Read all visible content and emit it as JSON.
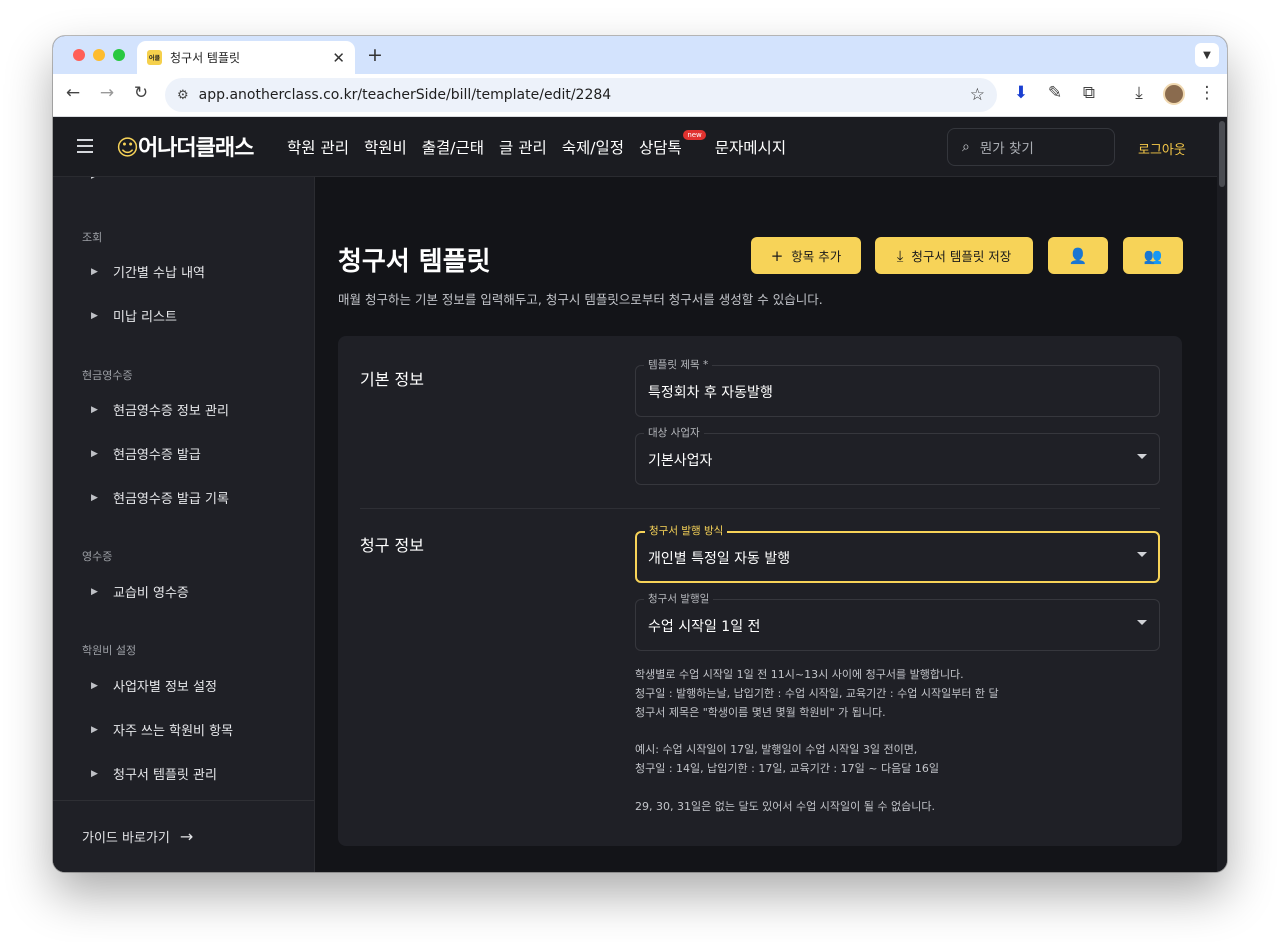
{
  "browser": {
    "tab_title": "청구서 템플릿",
    "favicon_text": "어클",
    "url": "app.anotherclass.co.kr/teacherSide/bill/template/edit/2284"
  },
  "appbar": {
    "logo_text": "어나더클래스",
    "nav": [
      "학원 관리",
      "학원비",
      "출결/근태",
      "글 관리",
      "숙제/일정",
      "상담톡",
      "문자메시지"
    ],
    "new_badge": "new",
    "search_placeholder": "뭔가 찾기",
    "logout": "로그아웃"
  },
  "sidebar": {
    "sections": [
      {
        "title": "조회",
        "items": [
          "기간별 수납 내역",
          "미납 리스트"
        ]
      },
      {
        "title": "현금영수증",
        "items": [
          "현금영수증 정보 관리",
          "현금영수증 발급",
          "현금영수증 발급 기록"
        ]
      },
      {
        "title": "영수증",
        "items": [
          "교습비 영수증"
        ]
      },
      {
        "title": "학원비 설정",
        "items": [
          "사업자별 정보 설정",
          "자주 쓰는 학원비 항목",
          "청구서 템플릿 관리"
        ]
      }
    ],
    "guide": "가이드 바로가기"
  },
  "main": {
    "title": "청구서 템플릿",
    "description": "매월 청구하는 기본 정보를 입력해두고, 청구시 템플릿으로부터 청구서를 생성할 수 있습니다.",
    "buttons": {
      "add_item": "항목 추가",
      "save_template": "청구서 템플릿 저장"
    },
    "basic": {
      "label": "기본 정보",
      "template_name_label": "템플릿 제목 *",
      "template_name_value": "특정회차 후 자동발행",
      "business_label": "대상 사업자",
      "business_value": "기본사업자"
    },
    "billing": {
      "label": "청구 정보",
      "method_label": "청구서 발행 방식",
      "method_value": "개인별 특정일 자동 발행",
      "date_label": "청구서 발행일",
      "date_value": "수업 시작일 1일 전",
      "help": [
        "학생별로 수업 시작일 1일 전 11시~13시 사이에 청구서를 발행합니다.",
        "청구일 : 발행하는날, 납입기한 : 수업 시작일, 교육기간 : 수업 시작일부터 한 달",
        "청구서 제목은 \"학생이름 몇년 몇월 학원비\" 가 됩니다.",
        "예시: 수업 시작일이 17일, 발행일이 수업 시작일 3일 전이면,",
        "청구일 : 14일, 납입기한 : 17일, 교육기간 : 17일 ~ 다음달 16일",
        "29, 30, 31일은 없는 달도 있어서 수업 시작일이 될 수 없습니다."
      ]
    }
  },
  "colors": {
    "accent": "#f7d358",
    "bg": "#131418",
    "panel": "#1f2026"
  }
}
